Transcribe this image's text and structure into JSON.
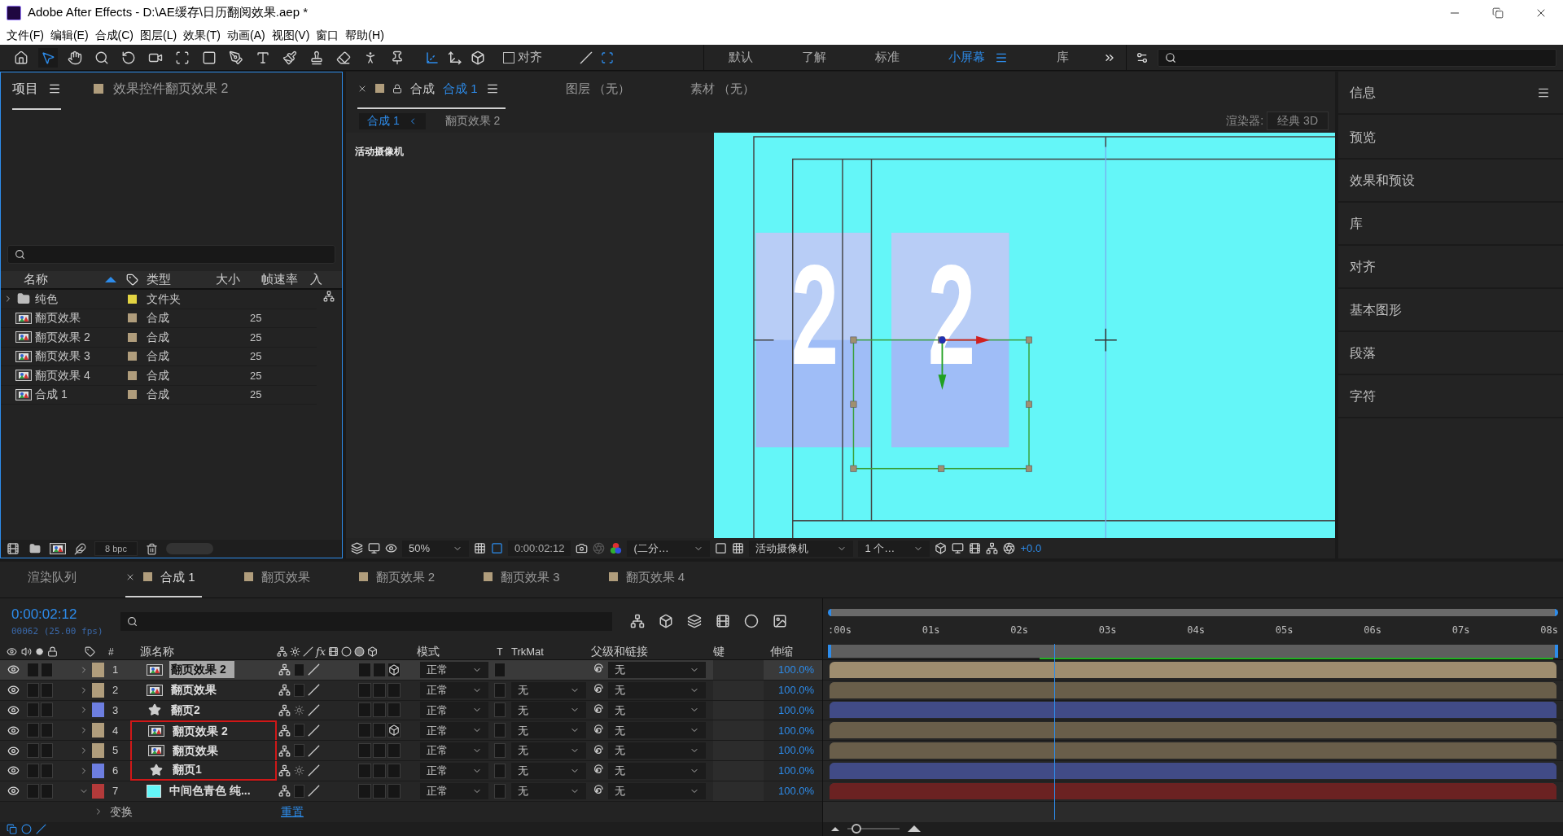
{
  "window": {
    "title": "Adobe After Effects - D:\\AE缓存\\日历翻阅效果.aep *"
  },
  "menu": [
    "文件(F)",
    "编辑(E)",
    "合成(C)",
    "图层(L)",
    "效果(T)",
    "动画(A)",
    "视图(V)",
    "窗口",
    "帮助(H)"
  ],
  "toolbar": {
    "align_label": "对齐",
    "align_checked": false,
    "workspaces": [
      {
        "label": "默认",
        "selected": false
      },
      {
        "label": "了解",
        "selected": false
      },
      {
        "label": "标准",
        "selected": false
      },
      {
        "label": "小屏幕",
        "selected": true
      },
      {
        "label": "库",
        "selected": false
      }
    ]
  },
  "project_panel": {
    "tabs": [
      {
        "label": "项目",
        "selected": true
      },
      {
        "label": "效果控件翻页效果 2",
        "selected": false
      }
    ],
    "columns": [
      "名称",
      "类型",
      "大小",
      "帧速率",
      "入"
    ],
    "items": [
      {
        "kind": "folder",
        "name": "纯色",
        "color": "#e3d442",
        "type": "文件夹",
        "expanded": false
      },
      {
        "kind": "comp",
        "name": "翻页效果",
        "color": "#b09d7c",
        "type": "合成",
        "frame_rate": "25"
      },
      {
        "kind": "comp",
        "name": "翻页效果 2",
        "color": "#b09d7c",
        "type": "合成",
        "frame_rate": "25"
      },
      {
        "kind": "comp",
        "name": "翻页效果 3",
        "color": "#b09d7c",
        "type": "合成",
        "frame_rate": "25"
      },
      {
        "kind": "comp",
        "name": "翻页效果 4",
        "color": "#b09d7c",
        "type": "合成",
        "frame_rate": "25"
      },
      {
        "kind": "comp",
        "name": "合成 1",
        "color": "#b09d7c",
        "type": "合成",
        "frame_rate": "25"
      }
    ],
    "bit_depth": "8 bpc"
  },
  "viewer": {
    "tabs": [
      {
        "kind": "comp",
        "label": "合成",
        "comp": "合成 1",
        "selected": true
      },
      {
        "kind": "plain",
        "label": "图层 （无）",
        "selected": false
      },
      {
        "kind": "plain",
        "label": "素材 （无）",
        "selected": false
      }
    ],
    "breadcrumbs": [
      {
        "label": "合成 1",
        "selected": true
      },
      {
        "label": "翻页效果 2",
        "selected": false
      }
    ],
    "renderer_label": "渲染器:",
    "renderer": "经典 3D",
    "camera_label": "活动摄像机",
    "canvas": {
      "digits": [
        "2",
        "2"
      ]
    },
    "footer": {
      "zoom": "50%",
      "timecode": "0:00:02:12",
      "resolution": "(二分…",
      "camera": "活动摄像机",
      "views": "1 个…",
      "exposure": "+0.0"
    }
  },
  "right_panel": {
    "items": [
      "信息",
      "预览",
      "效果和预设",
      "库",
      "对齐",
      "基本图形",
      "段落",
      "字符"
    ]
  },
  "timeline": {
    "tabs": [
      {
        "kind": "queue",
        "label": "渲染队列",
        "selected": false
      },
      {
        "kind": "comp",
        "label": "合成 1",
        "selected": true
      },
      {
        "kind": "comp",
        "label": "翻页效果",
        "selected": false
      },
      {
        "kind": "comp",
        "label": "翻页效果 2",
        "selected": false
      },
      {
        "kind": "comp",
        "label": "翻页效果 3",
        "selected": false
      },
      {
        "kind": "comp",
        "label": "翻页效果 4",
        "selected": false
      }
    ],
    "timecode": "0:00:02:12",
    "frame_info": "00062 (25.00 fps)",
    "columns": {
      "number": "#",
      "source": "源名称",
      "effects": "fx",
      "mode": "模式",
      "t": "T",
      "trkmat": "TrkMat",
      "parent": "父级和链接",
      "keys": "键",
      "stretch": "伸缩"
    },
    "layers": [
      {
        "number": "1",
        "kind": "comp",
        "name": "翻页效果 2",
        "color": "#b09d7c",
        "selected": true,
        "expanded": false,
        "three_d": true,
        "marked": false,
        "mode": "正常",
        "parent": "无",
        "stretch": "100.0%"
      },
      {
        "number": "2",
        "kind": "comp",
        "name": "翻页效果",
        "color": "#b09d7c",
        "selected": false,
        "expanded": false,
        "three_d": false,
        "marked": false,
        "mode": "正常",
        "trkmat": "无",
        "parent": "无",
        "stretch": "100.0%"
      },
      {
        "number": "3",
        "kind": "shape",
        "name": "翻页2",
        "color": "#6d7ee0",
        "selected": false,
        "expanded": false,
        "three_d": false,
        "marked": false,
        "mode": "正常",
        "trkmat": "无",
        "parent": "无",
        "stretch": "100.0%"
      },
      {
        "number": "4",
        "kind": "comp",
        "name": "翻页效果 2",
        "color": "#b09d7c",
        "selected": false,
        "expanded": false,
        "three_d": true,
        "marked": true,
        "mode": "正常",
        "trkmat": "无",
        "parent": "无",
        "stretch": "100.0%"
      },
      {
        "number": "5",
        "kind": "comp",
        "name": "翻页效果",
        "color": "#b09d7c",
        "selected": false,
        "expanded": false,
        "three_d": false,
        "marked": true,
        "mode": "正常",
        "trkmat": "无",
        "parent": "无",
        "stretch": "100.0%"
      },
      {
        "number": "6",
        "kind": "shape",
        "name": "翻页1",
        "color": "#6d7ee0",
        "selected": false,
        "expanded": false,
        "three_d": false,
        "marked": true,
        "mode": "正常",
        "trkmat": "无",
        "parent": "无",
        "stretch": "100.0%"
      },
      {
        "number": "7",
        "kind": "solid",
        "name": "中间色青色 纯...",
        "color": "#b33a3a",
        "selected": false,
        "expanded": true,
        "three_d": false,
        "marked": false,
        "mode": "正常",
        "trkmat": "无",
        "parent": "无",
        "stretch": "100.0%"
      }
    ],
    "transform_label": "变换",
    "reset_link": "重置",
    "ruler": [
      ":00s",
      "01s",
      "02s",
      "03s",
      "04s",
      "05s",
      "06s",
      "07s",
      "08s"
    ],
    "playhead": {
      "level": 0.31
    },
    "zoom": {
      "level": 0.1
    }
  }
}
